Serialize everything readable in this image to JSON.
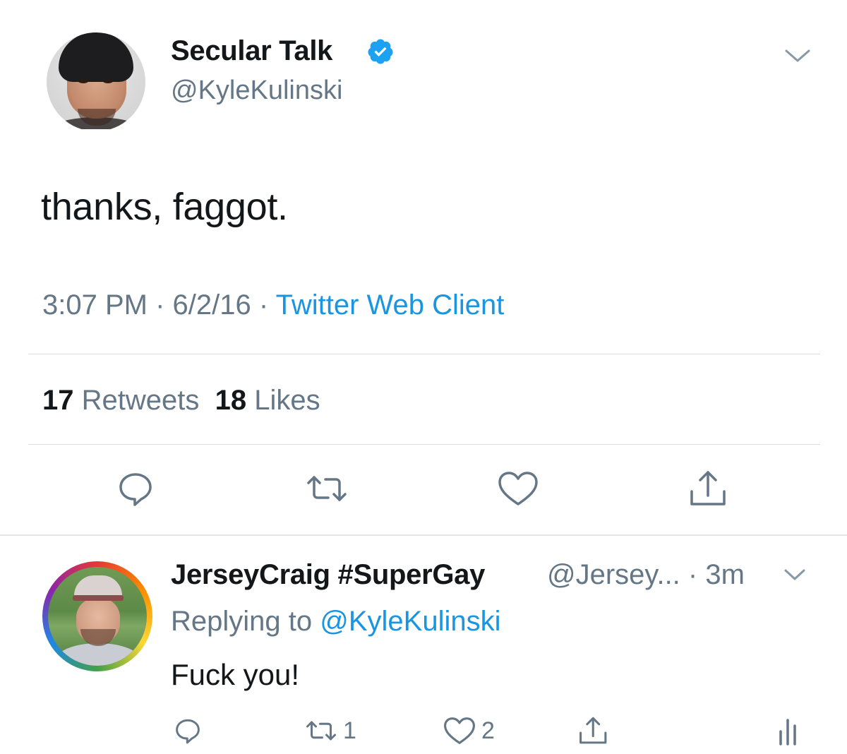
{
  "tweet": {
    "author_name": "Secular Talk",
    "author_handle": "@KyleKulinski",
    "verified_icon": "verified-badge-icon",
    "text": "thanks, faggot.",
    "time": "3:07 PM",
    "date": "6/2/16",
    "source": "Twitter Web Client",
    "retweets_count": "17",
    "retweets_label": "Retweets",
    "likes_count": "18",
    "likes_label": "Likes",
    "actions": [
      "reply-icon",
      "retweet-icon",
      "like-icon",
      "share-icon"
    ]
  },
  "reply": {
    "author_name": "JerseyCraig #SuperGay",
    "author_handle": "@Jersey...",
    "age": "3m",
    "replying_prefix": "Replying to",
    "replying_handle": "@KyleKulinski",
    "text": "Fuck you!",
    "retweet_count": "1",
    "like_count": "2",
    "actions": [
      "reply-icon",
      "retweet-icon",
      "like-icon",
      "share-icon",
      "analytics-icon"
    ]
  },
  "colors": {
    "link": "#1b95e0",
    "secondary_text": "#657786",
    "primary_text": "#14171a",
    "verified": "#1da1f2"
  }
}
